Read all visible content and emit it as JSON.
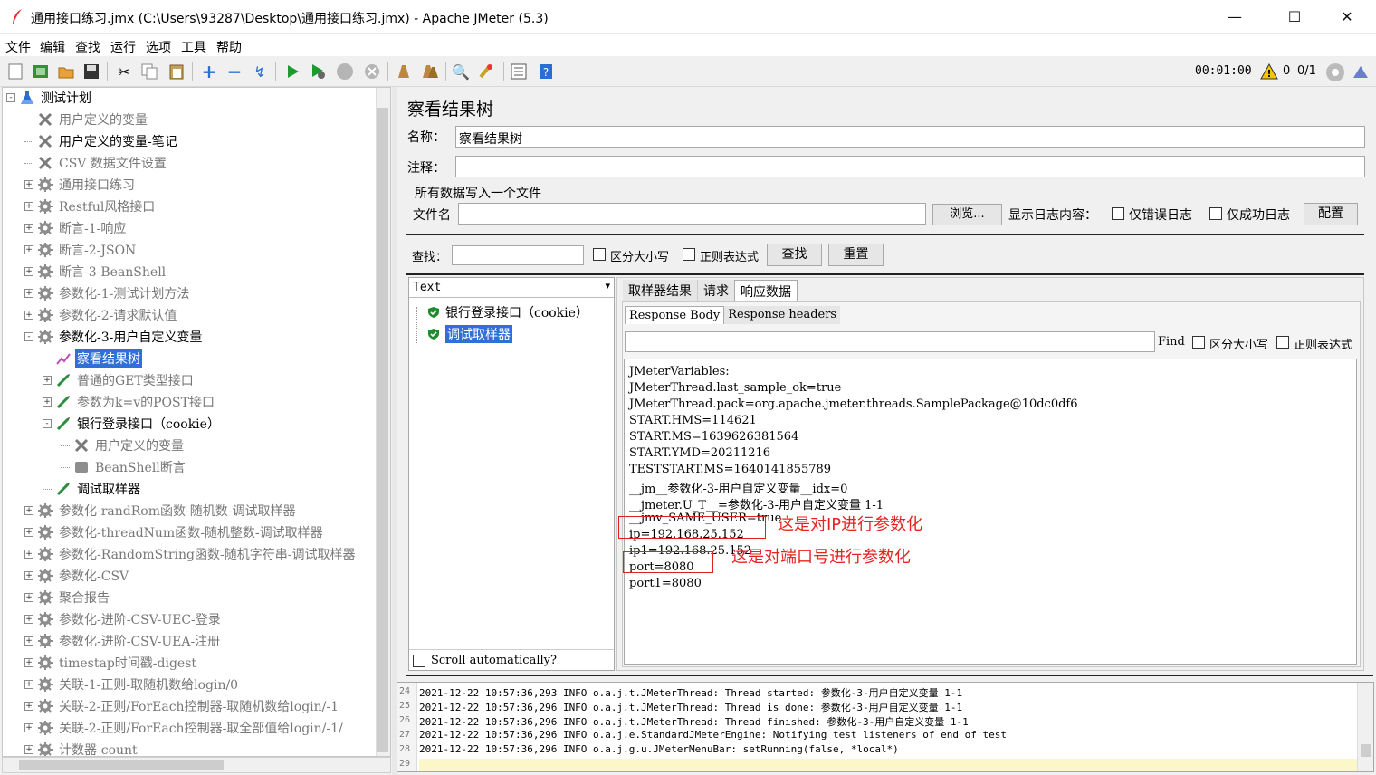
{
  "window": {
    "title": "通用接口练习.jmx (C:\\Users\\93287\\Desktop\\通用接口练习.jmx) - Apache JMeter (5.3)",
    "minimize": "—",
    "maximize": "☐",
    "close": "✕"
  },
  "menu": [
    "文件",
    "编辑",
    "查找",
    "运行",
    "选项",
    "工具",
    "帮助"
  ],
  "toolbar_status": {
    "timer": "00:01:00",
    "warnings": "0",
    "threads": "0/1"
  },
  "tree": [
    {
      "label": "测试计划",
      "icon": "test-plan-icon",
      "level": 0,
      "expander": "-"
    },
    {
      "label": "用户定义的变量",
      "icon": "wrench-icon",
      "level": 1,
      "dim": true
    },
    {
      "label": "用户定义的变量-笔记",
      "icon": "wrench-icon",
      "level": 1
    },
    {
      "label": "CSV 数据文件设置",
      "icon": "wrench-icon",
      "level": 1,
      "dim": true
    },
    {
      "label": "通用接口练习",
      "icon": "gear-icon",
      "level": 1,
      "expander": "+",
      "dim": true
    },
    {
      "label": "Restful风格接口",
      "icon": "gear-icon",
      "level": 1,
      "expander": "+",
      "dim": true
    },
    {
      "label": "断言-1-响应",
      "icon": "gear-icon",
      "level": 1,
      "expander": "+",
      "dim": true
    },
    {
      "label": "断言-2-JSON",
      "icon": "gear-icon",
      "level": 1,
      "expander": "+",
      "dim": true
    },
    {
      "label": "断言-3-BeanShell",
      "icon": "gear-icon",
      "level": 1,
      "expander": "+",
      "dim": true
    },
    {
      "label": "参数化-1-测试计划方法",
      "icon": "gear-icon",
      "level": 1,
      "expander": "+",
      "dim": true
    },
    {
      "label": "参数化-2-请求默认值",
      "icon": "gear-icon",
      "level": 1,
      "expander": "+",
      "dim": true
    },
    {
      "label": "参数化-3-用户自定义变量",
      "icon": "gear-icon",
      "level": 1,
      "expander": "-"
    },
    {
      "label": "察看结果树",
      "icon": "listener-icon",
      "level": 2,
      "selected": true
    },
    {
      "label": "普通的GET类型接口",
      "icon": "pen-icon",
      "level": 2,
      "expander": "+",
      "dim": true
    },
    {
      "label": "参数为k=v的POST接口",
      "icon": "pen-icon",
      "level": 2,
      "expander": "+",
      "dim": true
    },
    {
      "label": "银行登录接口（cookie）",
      "icon": "pen-icon",
      "level": 2,
      "expander": "-"
    },
    {
      "label": "用户定义的变量",
      "icon": "wrench-icon",
      "level": 3,
      "dim": true
    },
    {
      "label": "BeanShell断言",
      "icon": "assertion-icon",
      "level": 3,
      "dim": true
    },
    {
      "label": "调试取样器",
      "icon": "pen-icon",
      "level": 2
    },
    {
      "label": "参数化-randRom函数-随机数-调试取样器",
      "icon": "gear-icon",
      "level": 1,
      "expander": "+",
      "dim": true
    },
    {
      "label": "参数化-threadNum函数-随机整数-调试取样器",
      "icon": "gear-icon",
      "level": 1,
      "expander": "+",
      "dim": true
    },
    {
      "label": "参数化-RandomString函数-随机字符串-调试取样器",
      "icon": "gear-icon",
      "level": 1,
      "expander": "+",
      "dim": true
    },
    {
      "label": "参数化-CSV",
      "icon": "gear-icon",
      "level": 1,
      "expander": "+",
      "dim": true
    },
    {
      "label": "聚合报告",
      "icon": "gear-icon",
      "level": 1,
      "expander": "+",
      "dim": true
    },
    {
      "label": "参数化-进阶-CSV-UEC-登录",
      "icon": "gear-icon",
      "level": 1,
      "expander": "+",
      "dim": true
    },
    {
      "label": "参数化-进阶-CSV-UEA-注册",
      "icon": "gear-icon",
      "level": 1,
      "expander": "+",
      "dim": true
    },
    {
      "label": "timestap时间戳-digest",
      "icon": "gear-icon",
      "level": 1,
      "expander": "+",
      "dim": true
    },
    {
      "label": "关联-1-正则-取随机数给login/0",
      "icon": "gear-icon",
      "level": 1,
      "expander": "+",
      "dim": true
    },
    {
      "label": "关联-2-正则/ForEach控制器-取随机数给login/-1",
      "icon": "gear-icon",
      "level": 1,
      "expander": "+",
      "dim": true
    },
    {
      "label": "关联-2-正则/ForEach控制器-取全部值给login/-1/",
      "icon": "gear-icon",
      "level": 1,
      "expander": "+",
      "dim": true
    },
    {
      "label": "计数器-count",
      "icon": "gear-icon",
      "level": 1,
      "expander": "+",
      "dim": true
    }
  ],
  "panel": {
    "title": "察看结果树",
    "name_label": "名称：",
    "name_value": "察看结果树",
    "comment_label": "注释：",
    "comment_value": "",
    "file_section": "所有数据写入一个文件",
    "filename_label": "文件名",
    "browse_button": "浏览...",
    "log_content_label": "显示日志内容：",
    "errors_only": "仅错误日志",
    "success_only": "仅成功日志",
    "config_button": "配置",
    "search_label": "查找：",
    "case_sensitive": "区分大小写",
    "regex": "正则表达式",
    "search_button": "查找",
    "reset_button": "重置"
  },
  "results": {
    "renderer": "Text",
    "samples": [
      {
        "label": "银行登录接口（cookie）",
        "status": "success"
      },
      {
        "label": "调试取样器",
        "status": "success",
        "selected": true
      }
    ],
    "scroll_auto": "Scroll automatically?",
    "tabs": [
      "取样器结果",
      "请求",
      "响应数据"
    ],
    "active_tab": "响应数据",
    "subtabs": [
      "Response Body",
      "Response headers"
    ],
    "find_label": "Find",
    "find_case": "区分大小写",
    "find_regex": "正则表达式",
    "response_lines": [
      "JMeterVariables:",
      "JMeterThread.last_sample_ok=true",
      "JMeterThread.pack=org.apache.jmeter.threads.SamplePackage@10dc0df6",
      "START.HMS=114621",
      "START.MS=1639626381564",
      "START.YMD=20211216",
      "TESTSTART.MS=1640141855789",
      "__jm__参数化-3-用户自定义变量__idx=0",
      "__jmeter.U_T__=参数化-3-用户自定义变量 1-1",
      "__jmv_SAME_USER=true",
      "ip=192.168.25.152",
      "ip1=192.168.25.152",
      "port=8080",
      "port1=8080"
    ]
  },
  "annotations": {
    "ip_note": "这是对IP进行参数化",
    "port_note": "这是对端口号进行参数化"
  },
  "log": [
    {
      "n": "24",
      "text": "2021-12-22 10:57:36,293 INFO o.a.j.t.JMeterThread: Thread started: 参数化-3-用户自定义变量 1-1"
    },
    {
      "n": "25",
      "text": "2021-12-22 10:57:36,296 INFO o.a.j.t.JMeterThread: Thread is done: 参数化-3-用户自定义变量 1-1"
    },
    {
      "n": "26",
      "text": "2021-12-22 10:57:36,296 INFO o.a.j.t.JMeterThread: Thread finished: 参数化-3-用户自定义变量 1-1"
    },
    {
      "n": "27",
      "text": "2021-12-22 10:57:36,296 INFO o.a.j.e.StandardJMeterEngine: Notifying test listeners of end of test"
    },
    {
      "n": "28",
      "text": "2021-12-22 10:57:36,296 INFO o.a.j.g.u.JMeterMenuBar: setRunning(false, *local*)"
    },
    {
      "n": "29",
      "text": ""
    }
  ]
}
